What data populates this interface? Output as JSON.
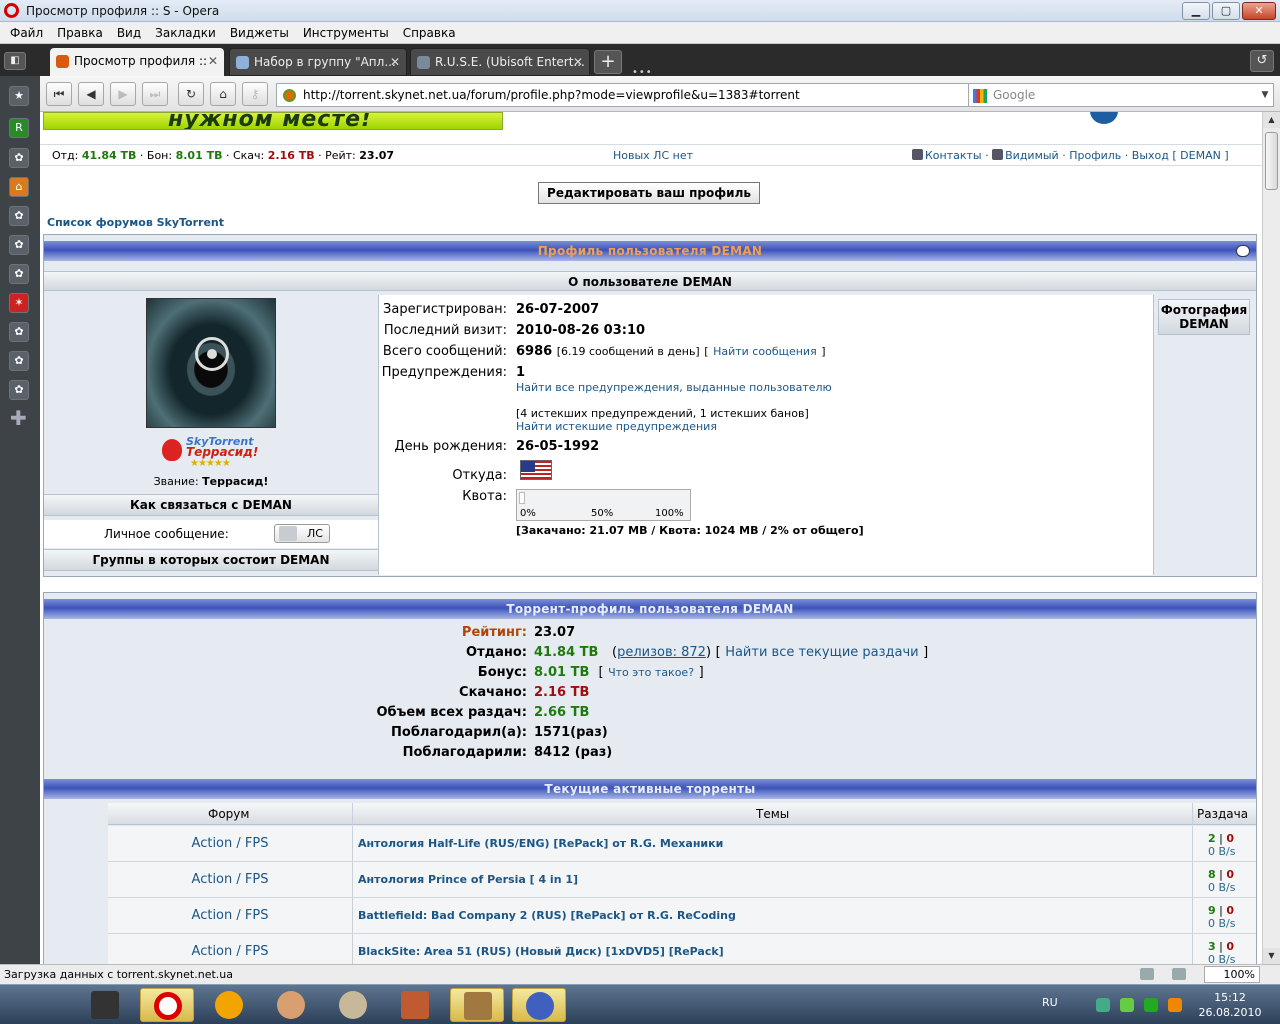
{
  "window": {
    "title": "Просмотр профиля :: S - Opera"
  },
  "menu": [
    "Файл",
    "Правка",
    "Вид",
    "Закладки",
    "Виджеты",
    "Инструменты",
    "Справка"
  ],
  "tabs": [
    {
      "label": "Просмотр профиля ::",
      "active": true
    },
    {
      "label": "Набор в группу \"Апл...",
      "active": false
    },
    {
      "label": "R.U.S.E. (Ubisoft Entert...",
      "active": false
    }
  ],
  "address": {
    "url": "http://torrent.skynet.net.ua/forum/profile.php?mode=viewprofile&u=1383#torrent"
  },
  "search": {
    "placeholder": "Google"
  },
  "banner": {
    "text": "нужном месте!"
  },
  "stats": {
    "given_label": "Отд:",
    "given": "41.84 TB",
    "bonus_label": "Бон:",
    "bonus": "8.01 TB",
    "down_label": "Скач:",
    "down": "2.16 TB",
    "rating_label": "Рейт:",
    "rating": "23.07",
    "new_pm": "Новых ЛС нет",
    "contacts": "Контакты",
    "visible": "Видимый",
    "profile": "Профиль",
    "logout": "Выход",
    "username": "DEMAN"
  },
  "edit_button": "Редактировать ваш профиль",
  "forum_list_link": "Список форумов SkyTorrent",
  "profile": {
    "caption": "Профиль пользователя DEMAN",
    "about": "О пользователе DEMAN",
    "rank_line1": "SkyTorrent",
    "rank_line2": "Террасид!",
    "rank_stars": "★★★★★",
    "rank_label": "Звание:",
    "rank": "Террасид!",
    "contact_head": "Как связаться с DEMAN",
    "pm_label": "Личное сообщение:",
    "pm_button": "ЛС",
    "groups_head": "Группы в которых состоит DEMAN",
    "photo_label": "Фотография",
    "photo_user": "DEMAN",
    "fields": {
      "registered_label": "Зарегистрирован:",
      "registered": "26-07-2007",
      "last_visit_label": "Последний визит:",
      "last_visit": "2010-08-26 03:10",
      "posts_label": "Всего сообщений:",
      "posts": "6986",
      "posts_per_day": "[6.19 сообщений в день]",
      "find_posts": "Найти сообщения",
      "warnings_label": "Предупреждения:",
      "warnings": "1",
      "find_warnings": "Найти все предупреждения, выданные пользователю",
      "expired": "[4 истекших предупреждений, 1 истекших банов]",
      "find_expired": "Найти истекшие предупреждения",
      "birthday_label": "День рождения:",
      "birthday": "26-05-1992",
      "from_label": "Откуда:",
      "quota_label": "Квота:",
      "quota_fraction": 0.02,
      "quota_ticks": [
        "0%",
        "50%",
        "100%"
      ],
      "quota_text": "[Закачано: 21.07 MB / Квота: 1024 MB / 2% от общего]"
    }
  },
  "torrent": {
    "caption": "Торрент-профиль пользователя DEMAN",
    "rows": [
      {
        "label": "Рейтинг:",
        "value": "23.07"
      },
      {
        "label": "Отдано:",
        "value": "41.84 TB",
        "extra_link": "релизов: 872",
        "extra_link2": "Найти все текущие раздачи"
      },
      {
        "label": "Бонус:",
        "value": "8.01 TB",
        "extra_link": "Что это такое?"
      },
      {
        "label": "Скачано:",
        "value": "2.16 TB"
      },
      {
        "label": "Объем всех раздач:",
        "value": "2.66 TB"
      },
      {
        "label": "Поблагодарил(а):",
        "value": "1571(раз)"
      },
      {
        "label": "Поблагодарили:",
        "value": "8412 (раз)"
      }
    ],
    "active_caption": "Текущие активные торренты",
    "col_forum": "Форум",
    "col_topics": "Темы",
    "col_seed": "Раздача",
    "items": [
      {
        "forum": "Action / FPS",
        "topic": "Антология Half-Life (RUS/ENG) [RePack] от R.G. Механики",
        "seeds": "2",
        "leech": "0",
        "speed": "0 B/s"
      },
      {
        "forum": "Action / FPS",
        "topic": "Антология Prince of Persia [ 4 in 1]",
        "seeds": "8",
        "leech": "0",
        "speed": "0 B/s"
      },
      {
        "forum": "Action / FPS",
        "topic": "Battlefield: Bad Company 2 (RUS) [RePack] от R.G. ReCoding",
        "seeds": "9",
        "leech": "0",
        "speed": "0 B/s"
      },
      {
        "forum": "Action / FPS",
        "topic": "BlackSite: Area 51 (RUS) (Новый Диск) [1xDVD5] [RePack]",
        "seeds": "3",
        "leech": "0",
        "speed": "0 B/s"
      }
    ]
  },
  "statusbar": {
    "message": "Загрузка данных с torrent.skynet.net.ua",
    "zoom": "100%"
  },
  "tray": {
    "lang": "RU",
    "time": "15:12",
    "date": "26.08.2010"
  }
}
